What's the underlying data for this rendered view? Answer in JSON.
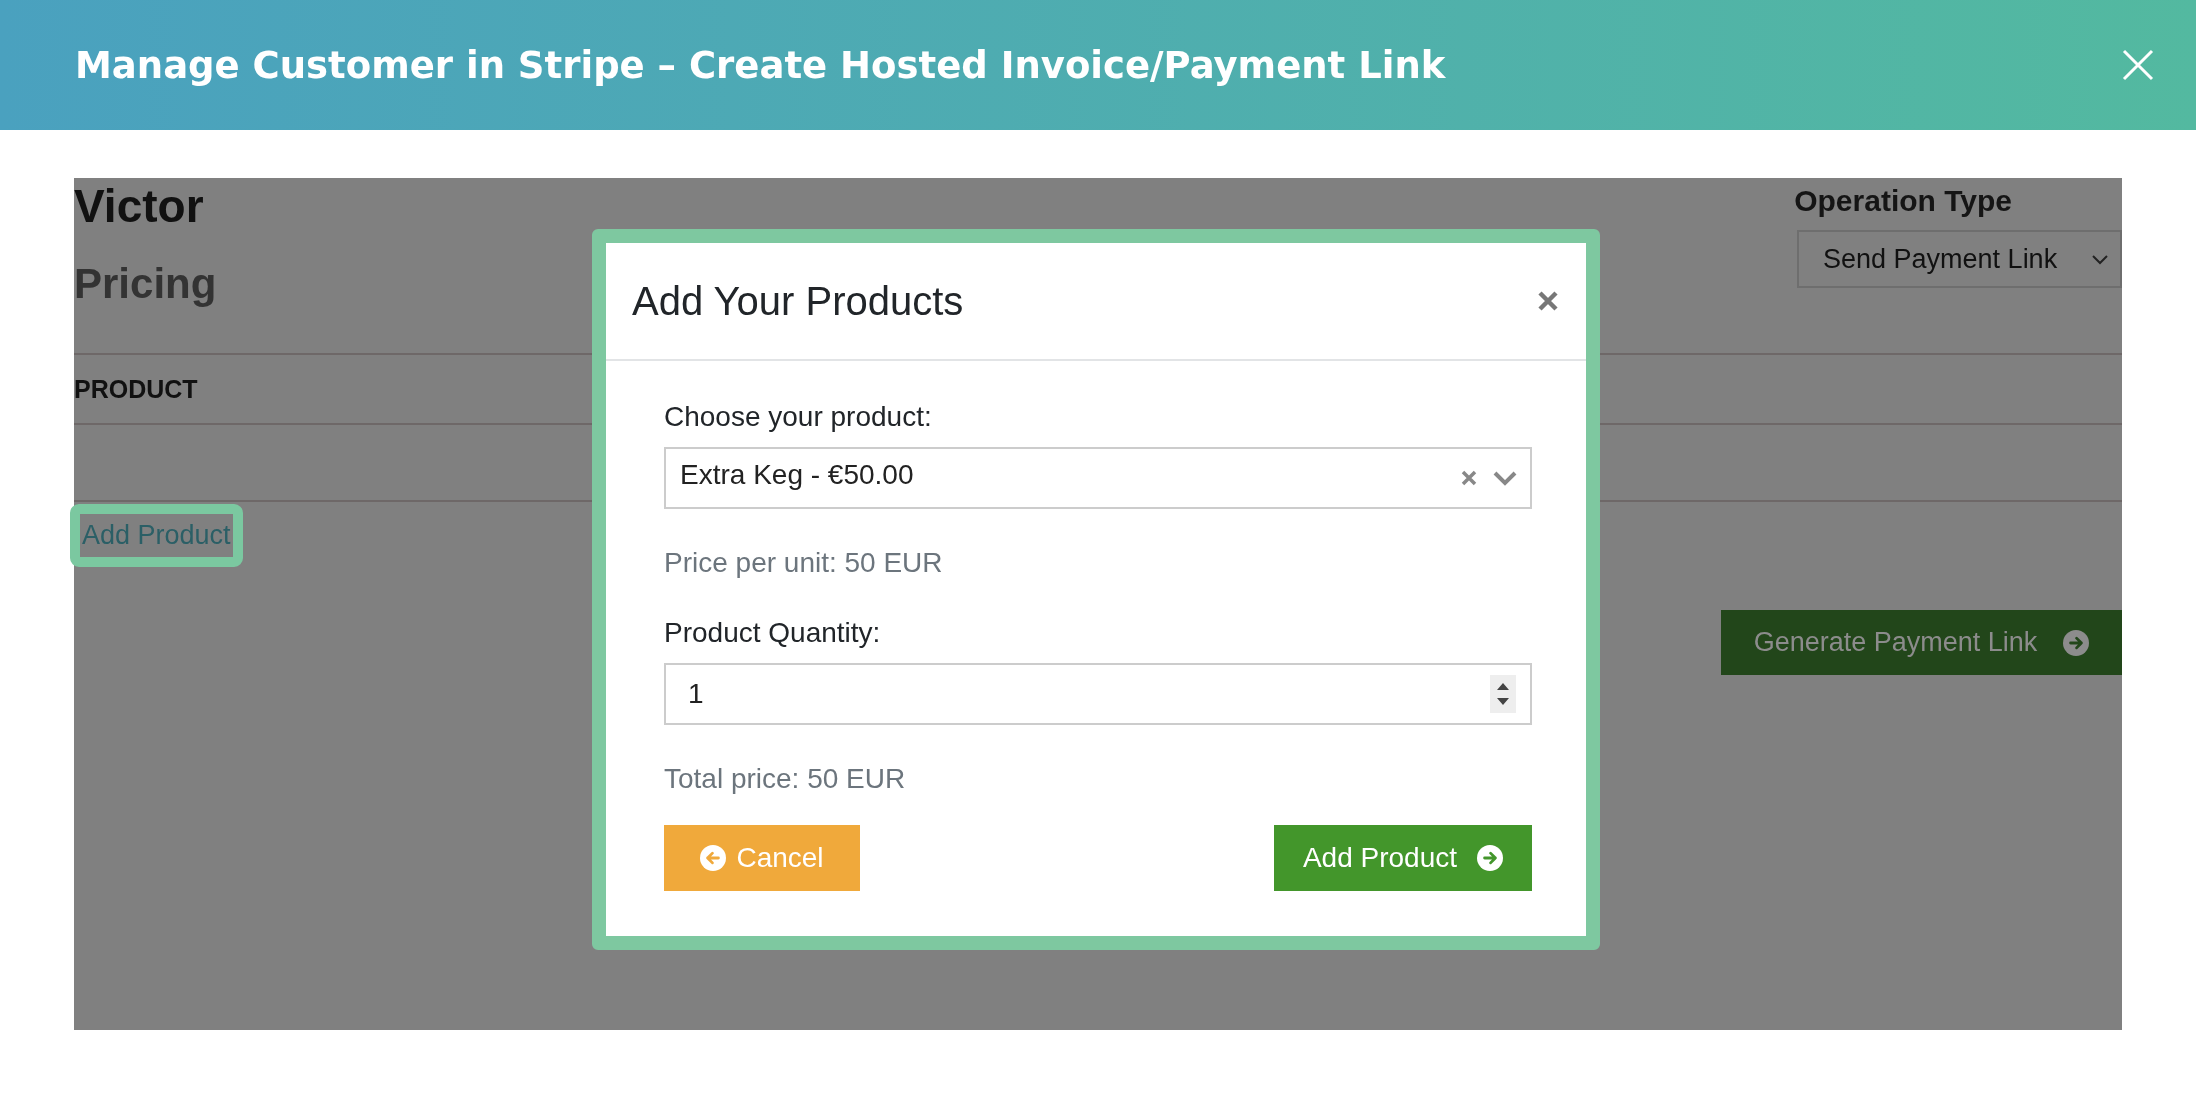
{
  "window": {
    "title": "Manage Customer in Stripe – Create Hosted Invoice/Payment Link"
  },
  "page": {
    "customer_name": "Victor",
    "section_title": "Pricing",
    "table": {
      "columns": [
        "PRODUCT"
      ]
    },
    "add_product": {
      "label": "Add Product",
      "highlighted": true
    },
    "operation_type": {
      "label": "Operation Type",
      "value": "Send Payment Link"
    },
    "generate_button": {
      "label": "Generate Payment Link"
    }
  },
  "modal": {
    "title": "Add Your Products",
    "product_label": "Choose your product:",
    "product_value": "Extra Keg - €50.00",
    "price_per_unit": "Price per unit: 50 EUR",
    "quantity_label": "Product Quantity:",
    "quantity_value": "1",
    "total_price": "Total price: 50 EUR",
    "buttons": [
      {
        "label": "Cancel",
        "kind": "cancel"
      },
      {
        "label": "Add Product",
        "kind": "add"
      }
    ]
  }
}
